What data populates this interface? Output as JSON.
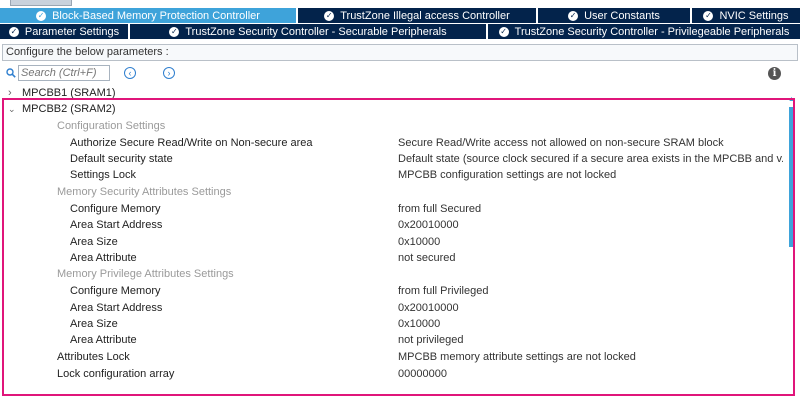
{
  "tabs_row1": [
    {
      "label": "Block-Based Memory Protection Controller",
      "active": true
    },
    {
      "label": "TrustZone Illegal access Controller",
      "active": false
    },
    {
      "label": "User Constants",
      "active": false
    },
    {
      "label": "NVIC Settings",
      "active": false
    }
  ],
  "tabs_row2": [
    {
      "label": "Parameter Settings",
      "active": false
    },
    {
      "label": "TrustZone Security Controller - Securable Peripherals",
      "active": false
    },
    {
      "label": "TrustZone Security Controller - Privilegeable Peripherals",
      "active": false
    }
  ],
  "config_bar": "Configure the below parameters :",
  "search": {
    "placeholder": "Search (Ctrl+F)"
  },
  "tree": {
    "mpcbb1": "MPCBB1 (SRAM1)",
    "mpcbb2": "MPCBB2 (SRAM2)",
    "config_settings": "Configuration Settings",
    "authorize_label": "Authorize Secure Read/Write on Non-secure area",
    "authorize_value": "Secure Read/Write access not allowed on non-secure SRAM block",
    "default_state_label": "Default security state",
    "default_state_value": "Default state (source clock secured if a secure area exists in the MPCBB and v...",
    "settings_lock_label": "Settings Lock",
    "settings_lock_value": "MPCBB configuration settings are not locked",
    "mem_sec_settings": "Memory Security Attributes Settings",
    "sec_configure_label": "Configure Memory",
    "sec_configure_value": "from full Secured",
    "sec_start_label": "Area Start Address",
    "sec_start_value": "0x20010000",
    "sec_size_label": "Area Size",
    "sec_size_value": "0x10000",
    "sec_attr_label": "Area Attribute",
    "sec_attr_value": "not secured",
    "mem_priv_settings": "Memory Privilege Attributes Settings",
    "priv_configure_label": "Configure Memory",
    "priv_configure_value": "from full Privileged",
    "priv_start_label": "Area Start Address",
    "priv_start_value": "0x20010000",
    "priv_size_label": "Area Size",
    "priv_size_value": "0x10000",
    "priv_attr_label": "Area Attribute",
    "priv_attr_value": "not privileged",
    "attr_lock_label": "Attributes Lock",
    "attr_lock_value": "MPCBB memory attribute settings are not locked",
    "lock_array_label": "Lock configuration array",
    "lock_array_value": "00000000"
  },
  "colors": {
    "tab_bg": "#03234b",
    "tab_active": "#3ea3da",
    "highlight": "#e0157a"
  },
  "icons": {
    "search": "search-icon",
    "prev": "arrow-left-icon",
    "next": "arrow-right-icon",
    "info": "info-icon"
  }
}
